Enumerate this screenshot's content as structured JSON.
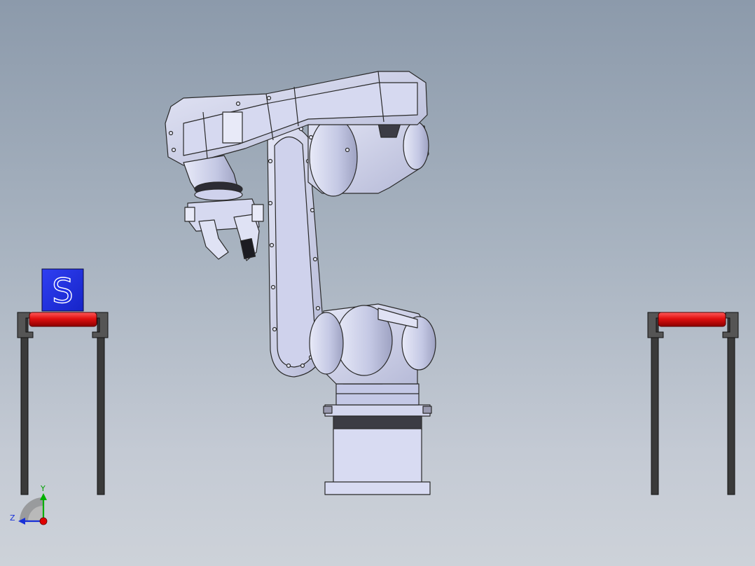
{
  "scene": {
    "box_letter": "S",
    "triad": {
      "y_label": "Y",
      "z_label": "Z"
    }
  },
  "colors": {
    "background_top": "#8c9aab",
    "background_bottom": "#cdd2d9",
    "box_blue": "#1f2fe6",
    "roller_red": "#e01010",
    "robot_body": "#c8ccea",
    "outline": "#2a2a2a"
  }
}
